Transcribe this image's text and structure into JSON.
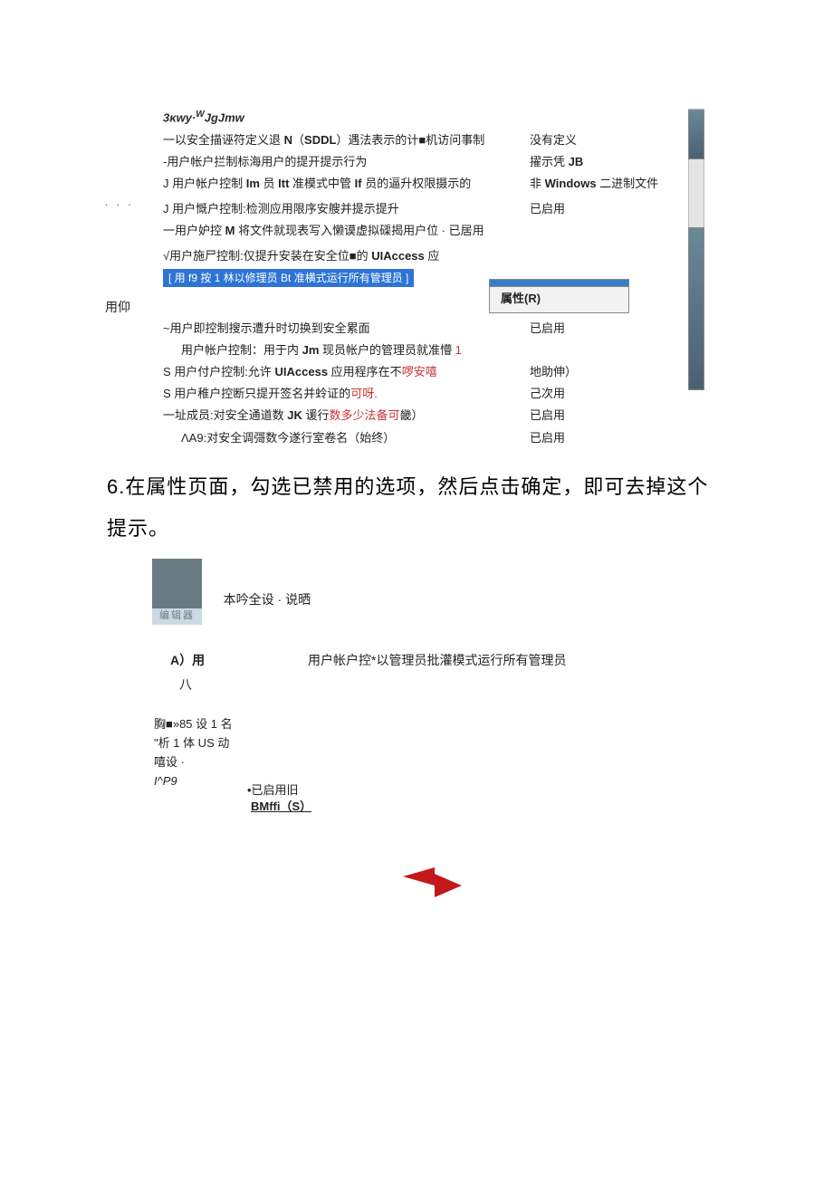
{
  "topHeader": "3κwy·<sup>W</sup>JgJmw",
  "policies": [
    {
      "label": "一以安全描诬符定义退 <b>N</b>（<b>SDDL</b>）遇法表示的计■机访问事制",
      "value": "没有定义"
    },
    {
      "label": "-用户帐户拦制标海用户的提开提示行为",
      "value": "擢示凭 <b>JB</b>"
    },
    {
      "label": "J 用户帐户控制 <b>Im</b> 员 <b>Itt</b> 准模式中管 <b>If</b> 员的逼升权限摄示的",
      "value": "非 <b>Windows</b> 二进制文件",
      "gapAfter": true
    },
    {
      "label": "J 用户慨户控制:检测应用限序安艘并提示提升",
      "value": "已启用"
    },
    {
      "label": "一用户妒控 <b>M</b> 将文件就现表写入懒谟虚拟磲揭用户位 · 已居用",
      "value": "",
      "gapAfter": true
    },
    {
      "label": "√用户施尸控制:仅提升安装在安全位■的 <b>UIAccess</b> 应",
      "value": ""
    }
  ],
  "selectedRow": "[ 用 f9 按 1 林以修理员 Bt 准横式运行所有管理员 ]",
  "contextMenu": "属性(R)",
  "belowCtx": "已启用",
  "sideText": "用仰",
  "dotsSide": ". . .",
  "afterSelected": [
    {
      "label": "~用户即控制搜示遭升时切换到安全累面",
      "value": "已启用"
    },
    {
      "label": "用户帐户控制：用于内 <b>Jm</b> 现员帐户的管理员就准懵 <span class=\"red\">1</span>",
      "value": "",
      "indent": true
    },
    {
      "label": "S 用户付户控制:允许 <b>UIAccess</b> 应用程序在不<span class=\"red\">啰安嘻</span>",
      "value": "地助伸）"
    },
    {
      "label": "S 用户稚户控断只提开签名并蛉证的<span class=\"red\">可呀.</span>",
      "value": "己次用"
    },
    {
      "label": "一址成员:对安全通道数 <b>JK</b> 谖行<span class=\"red\">数多少法备可</span>畿）",
      "value": "已启用"
    },
    {
      "label": "ΛA9:对安全调彁数今遂行室卷名（始终）",
      "value": "已启用",
      "indent": true
    }
  ],
  "step6": "6.在属性页面，勾选已禁用的选项，然后点击确定，即可去掉这个提示。",
  "dialog": {
    "iconLabel": "编辑器",
    "tabs": "本吟全设 · 说晒",
    "lineA_left": "A）用",
    "lineA_right": "用户帐户控*以管理员批灌模式运行所有管理员",
    "line8": "八",
    "leftList": [
      "胸■»85 设 1 名",
      "\"析 1 体 US 动",
      "嘻设 ·",
      "I^P9"
    ],
    "enabledLabel": "•已启用旧",
    "buttonLabel": "BMffi（S）"
  }
}
